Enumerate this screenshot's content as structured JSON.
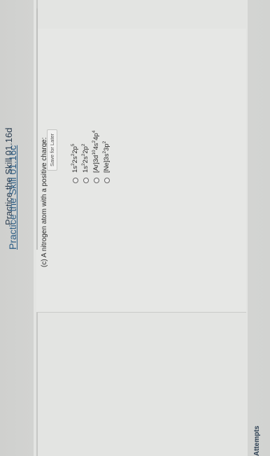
{
  "practice_c": {
    "heading": "Practice the Skill 01.16c",
    "question": "(c) A nitrogen atom with a positive charge:",
    "choices": [
      {
        "text": "1s2s2p",
        "sups": [
          "2",
          "2",
          "5"
        ]
      },
      {
        "text": "1s2s2p",
        "sups": [
          "2",
          "2",
          "2"
        ]
      },
      {
        "text": "[Ar]3d4s4p",
        "sups": [
          "10",
          "2",
          "4"
        ]
      },
      {
        "text": "[Ne]3s3p",
        "sups": [
          "2",
          "2"
        ]
      }
    ],
    "save_label": "Save for Later",
    "attempts_label": "Attempts"
  },
  "practice_d": {
    "heading": "Practice the Skill 01.16d"
  },
  "colors": {
    "link": "#2f5f86",
    "heading": "#2c3f52",
    "background": "#d4d4d2"
  }
}
